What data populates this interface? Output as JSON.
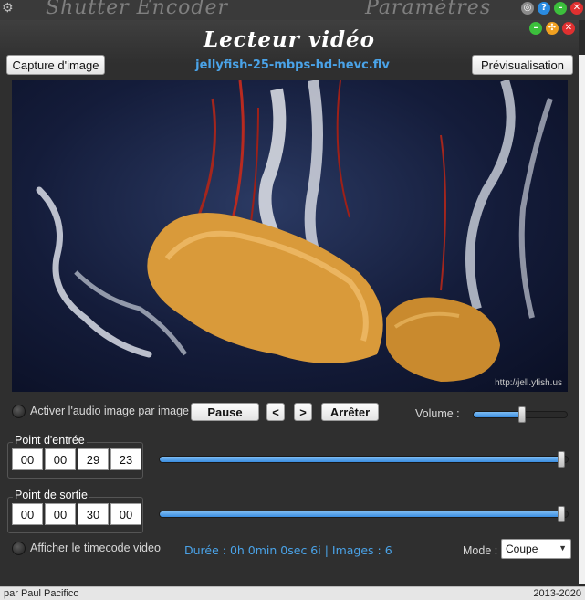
{
  "background_app": {
    "title_left": "Shutter Encoder",
    "title_right": "Paramètres"
  },
  "dialog": {
    "title": "Lecteur vidéo",
    "capture_label": "Capture d'image",
    "filename": "jellyfish-25-mbps-hd-hevc.flv",
    "preview_label": "Prévisualisation",
    "video_watermark": "http://jell.yfish.us"
  },
  "controls": {
    "audio_frame_label": "Activer l'audio image par image",
    "pause_label": "Pause",
    "prev_label": "<",
    "next_label": ">",
    "stop_label": "Arrêter",
    "volume_label": "Volume :",
    "volume_level": 0.52
  },
  "in_point": {
    "legend": "Point d'entrée",
    "hours": "00",
    "minutes": "00",
    "seconds": "29",
    "frames": "23",
    "slider_level": 0.985
  },
  "out_point": {
    "legend": "Point de sortie",
    "hours": "00",
    "minutes": "00",
    "seconds": "30",
    "frames": "00",
    "slider_level": 0.985
  },
  "footer": {
    "timecode_label": "Afficher le timecode video",
    "duration_text": "Durée : 0h 0min 0sec 6i | Images : 6",
    "mode_label": "Mode :",
    "mode_value": "Coupe"
  },
  "status": {
    "author": "par Paul Pacifico",
    "years": "2013-2020"
  },
  "colors": {
    "accent": "#4aa3e8",
    "close": "#e03030",
    "minimize": "#3cbf3c",
    "maximize": "#f0a020"
  }
}
